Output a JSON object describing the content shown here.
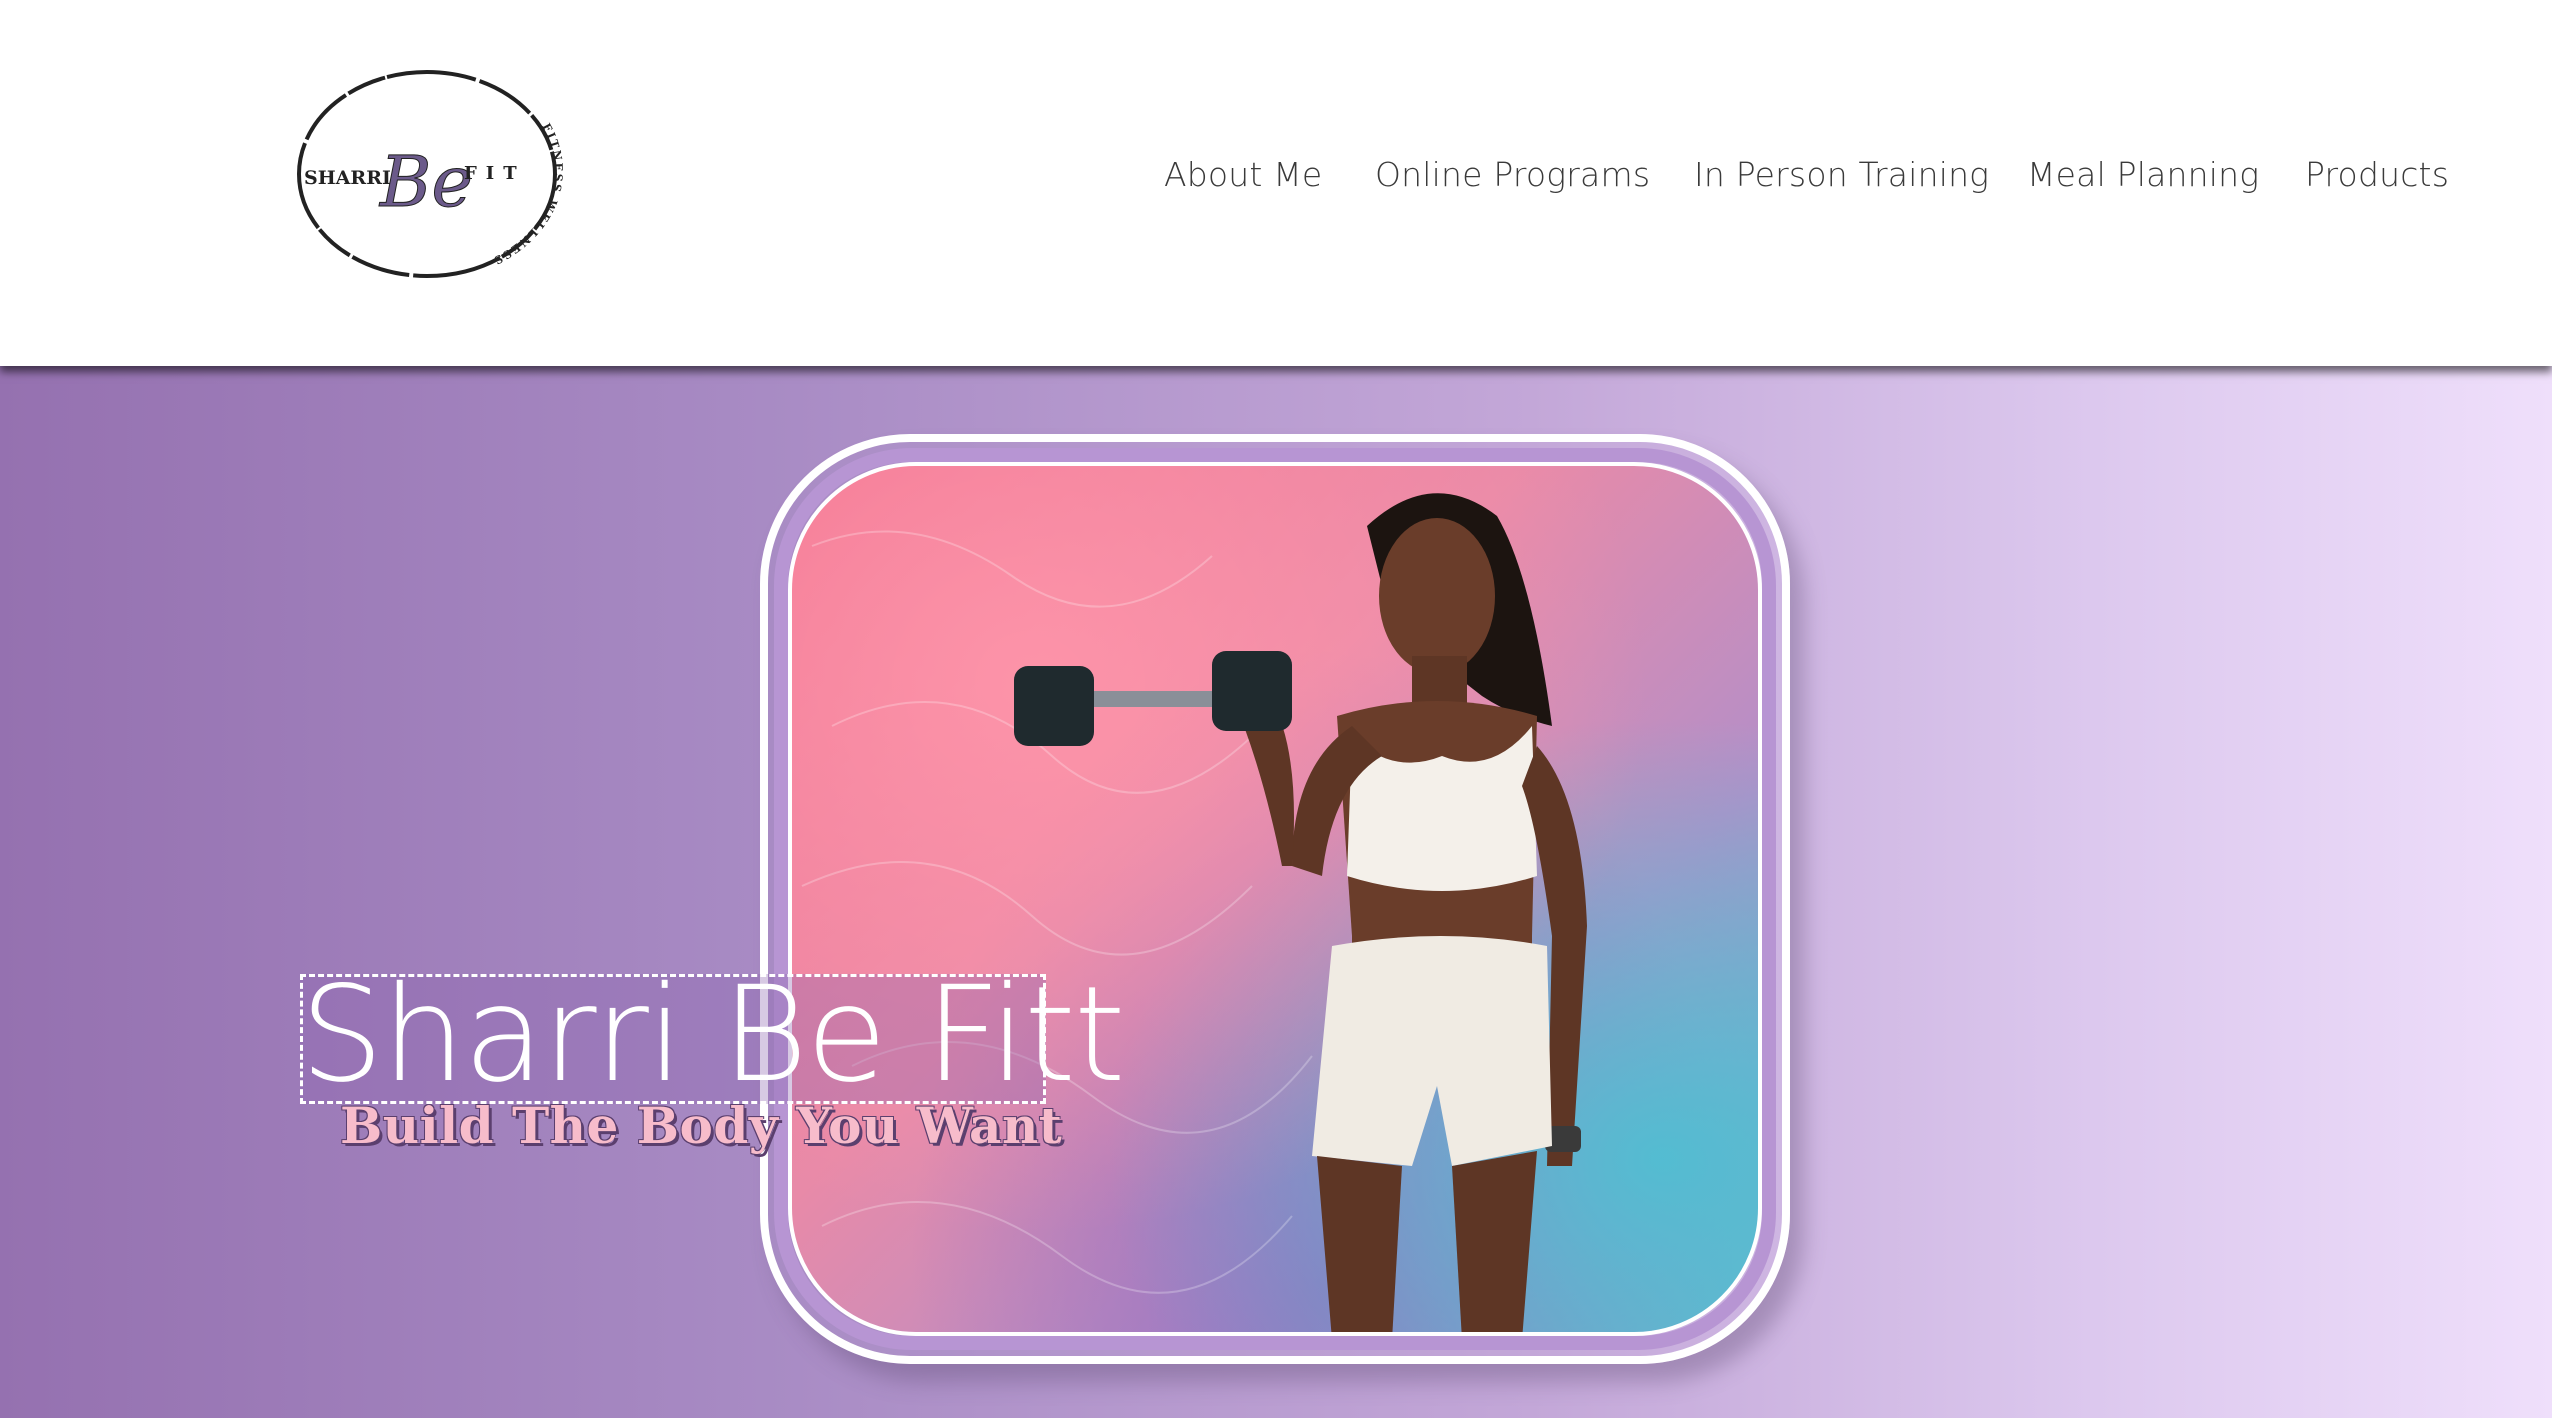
{
  "brand": {
    "logo_text_left": "SHARRI",
    "logo_script": "Be",
    "logo_text_right": "FIT",
    "logo_arc_text": "FITNESS WELLNESS"
  },
  "nav": {
    "items": [
      {
        "label": "About Me"
      },
      {
        "label": "Online Programs"
      },
      {
        "label": "In Person Training"
      },
      {
        "label": "Meal Planning"
      },
      {
        "label": "Products"
      }
    ]
  },
  "hero": {
    "title": "Sharri Be Fitt",
    "subtitle": "Build The Body You Want"
  },
  "colors": {
    "hero_gradient_start": "#9571b0",
    "hero_gradient_end": "#efdffb",
    "frame_purple": "#b795d3",
    "subtitle_pink": "#f7bccb"
  }
}
